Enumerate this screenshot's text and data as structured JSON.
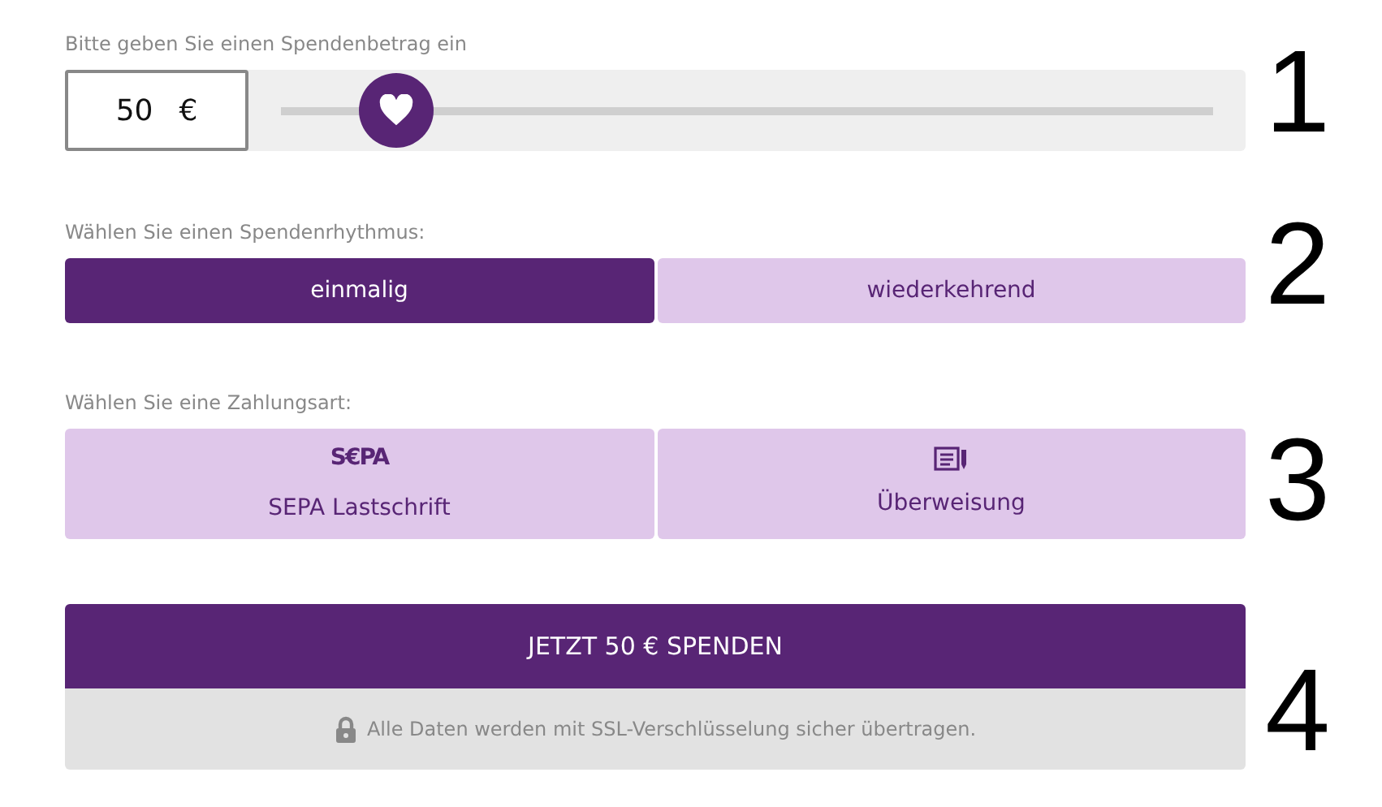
{
  "amount": {
    "label": "Bitte geben Sie einen Spendenbetrag ein",
    "value": "50",
    "currency": "€",
    "level": 0.124,
    "step": "1"
  },
  "rhythm": {
    "label": "Wählen Sie einen Spendenrhythmus:",
    "step": "2",
    "options": [
      {
        "label": "einmalig",
        "selected": true
      },
      {
        "label": "wiederkehrend",
        "selected": false
      }
    ]
  },
  "payment": {
    "label": "Wählen Sie eine Zahlungsart:",
    "step": "3",
    "options": [
      {
        "kind": "sepa",
        "logo": "S€PA",
        "label": "SEPA Lastschrift",
        "selected": false
      },
      {
        "kind": "transfer",
        "label": "Überweisung",
        "selected": false
      }
    ]
  },
  "submit": {
    "label": "JETZT 50 € SPENDEN",
    "step": "4",
    "note": "Alle Daten werden mit SSL-Verschlüsselung sicher übertragen."
  }
}
